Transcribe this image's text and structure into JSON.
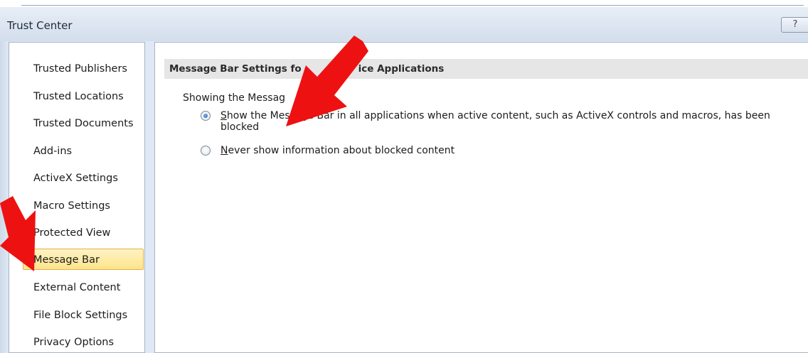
{
  "window": {
    "title": "Trust Center",
    "help_label": "?"
  },
  "sidebar": {
    "items": [
      {
        "label": "Trusted Publishers",
        "selected": false
      },
      {
        "label": "Trusted Locations",
        "selected": false
      },
      {
        "label": "Trusted Documents",
        "selected": false
      },
      {
        "label": "Add-ins",
        "selected": false
      },
      {
        "label": "ActiveX Settings",
        "selected": false
      },
      {
        "label": "Macro Settings",
        "selected": false
      },
      {
        "label": "Protected View",
        "selected": false
      },
      {
        "label": "Message Bar",
        "selected": true
      },
      {
        "label": "External Content",
        "selected": false
      },
      {
        "label": "File Block Settings",
        "selected": false
      },
      {
        "label": "Privacy Options",
        "selected": false
      }
    ]
  },
  "main": {
    "section_title_start": "Message Bar Settings fo",
    "section_title_end": "ice Applications",
    "group_label": "Showing the Messag",
    "options": [
      {
        "accel": "S",
        "label_rest": "how the Message Bar in all applications when active content, such as ActiveX controls and macros, has been blocked",
        "checked": true
      },
      {
        "accel": "N",
        "label_rest": "ever show information about blocked content",
        "checked": false
      }
    ]
  },
  "annotations": {
    "arrow_color": "#ee1111"
  }
}
